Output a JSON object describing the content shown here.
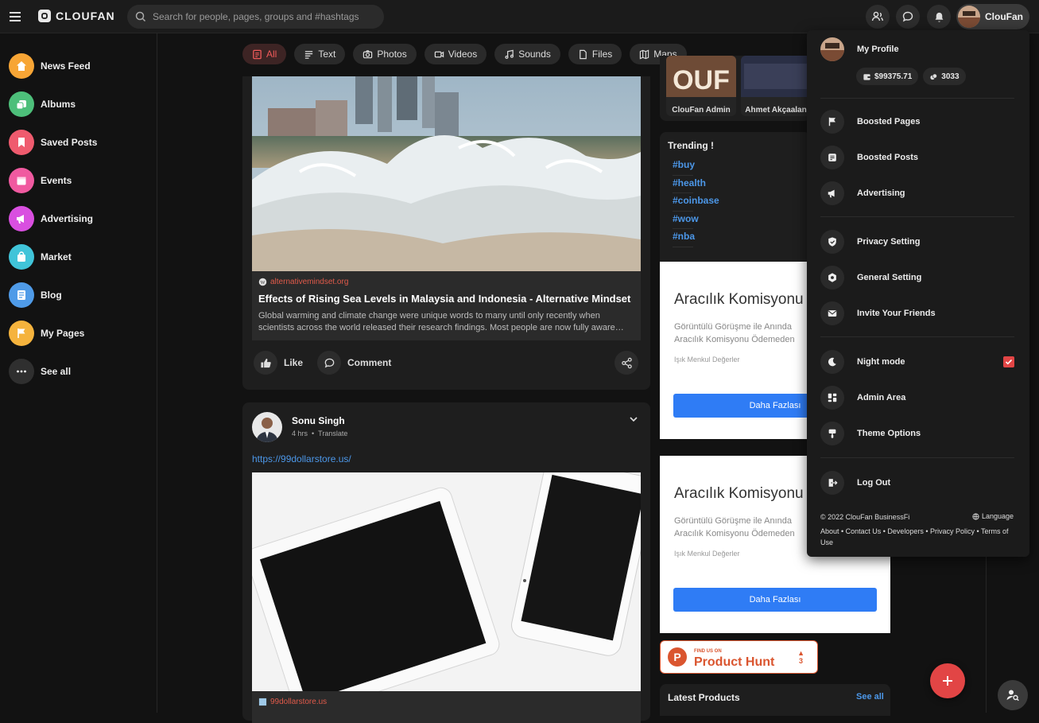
{
  "app": {
    "name": "CLOUFAN"
  },
  "search": {
    "placeholder": "Search for people, pages, groups and #hashtags"
  },
  "user": {
    "name": "ClouFan"
  },
  "sidebar": {
    "items": [
      {
        "label": "News Feed",
        "icon": "home-icon",
        "color": "#f7a535"
      },
      {
        "label": "Albums",
        "icon": "albums-icon",
        "color": "#4dbf7a"
      },
      {
        "label": "Saved Posts",
        "icon": "bookmark-icon",
        "color": "#ef5b6e"
      },
      {
        "label": "Events",
        "icon": "calendar-icon",
        "color": "#f05aa0"
      },
      {
        "label": "Advertising",
        "icon": "megaphone-icon",
        "color": "#d94fe0"
      },
      {
        "label": "Market",
        "icon": "shopping-bag-icon",
        "color": "#40c4d9"
      },
      {
        "label": "Blog",
        "icon": "blog-icon",
        "color": "#4f9be8"
      },
      {
        "label": "My Pages",
        "icon": "flag-icon",
        "color": "#f5b33d"
      },
      {
        "label": "See all",
        "icon": "more-icon",
        "color": "#2f2f2f"
      }
    ]
  },
  "filters": [
    {
      "label": "All",
      "icon": "all-icon",
      "active": true
    },
    {
      "label": "Text",
      "icon": "text-icon"
    },
    {
      "label": "Photos",
      "icon": "camera-icon"
    },
    {
      "label": "Videos",
      "icon": "video-icon"
    },
    {
      "label": "Sounds",
      "icon": "music-icon"
    },
    {
      "label": "Files",
      "icon": "file-icon"
    },
    {
      "label": "Maps",
      "icon": "map-icon"
    }
  ],
  "post1": {
    "source": "alternativemindset.org",
    "title": "Effects of Rising Sea Levels in Malaysia and Indonesia - Alternative Mindset",
    "description": "Global warming and climate change were unique words to many until only recently when scientists across the world released their research findings. Most people are now fully aware…",
    "like_label": "Like",
    "comment_label": "Comment"
  },
  "post2": {
    "author": "Sonu Singh",
    "time": "4 hrs",
    "translate": "Translate",
    "link": "https://99dollarstore.us/",
    "source": "99dollarstore.us"
  },
  "pages_strip": [
    {
      "name": "ClouFan Admin"
    },
    {
      "name": "Ahmet Akçaalan"
    }
  ],
  "trending": {
    "title": "Trending !",
    "tags": [
      "#buy",
      "#health",
      "#coinbase",
      "#wow",
      "#nba"
    ]
  },
  "ads": [
    {
      "title": "Aracılık Komisyonu Artık",
      "text": "Görüntülü Görüşme ile Anında Aracılık Komisyonu Ödemeden",
      "company": "Işık Menkul Değerler",
      "button": "Daha Fazlası"
    },
    {
      "title": "Aracılık Komisyonu Artık",
      "text": "Görüntülü Görüşme ile Anında Aracılık Komisyonu Ödemeden",
      "company": "Işık Menkul Değerler",
      "button": "Daha Fazlası"
    }
  ],
  "producthunt": {
    "small": "FIND US ON",
    "big": "Product Hunt",
    "count": "3"
  },
  "latest": {
    "title": "Latest Products",
    "see_all": "See all"
  },
  "menu": {
    "profile": "My Profile",
    "wallet": "$99375.71",
    "points": "3033",
    "items": {
      "boosted_pages": "Boosted Pages",
      "boosted_posts": "Boosted Posts",
      "advertising": "Advertising",
      "privacy": "Privacy Setting",
      "general": "General Setting",
      "invite": "Invite Your Friends",
      "night": "Night mode",
      "admin": "Admin Area",
      "theme": "Theme Options",
      "logout": "Log Out"
    },
    "night_mode_on": true,
    "copyright": "© 2022 ClouFan BusinessFi",
    "language": "Language",
    "footer_links": "About • Contact Us • Developers • Privacy Policy • Terms of Use"
  },
  "colors": {
    "accent": "#e24545",
    "link": "#4c97e8",
    "ad_button": "#2f7cf5"
  }
}
